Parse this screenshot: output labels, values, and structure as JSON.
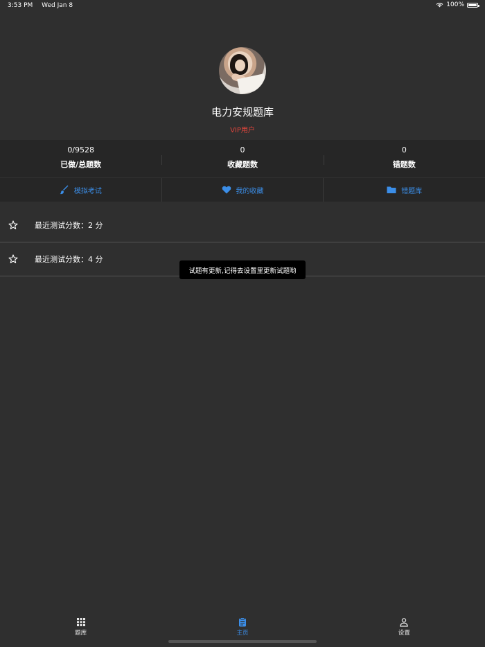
{
  "status_bar": {
    "time": "3:53 PM",
    "date": "Wed Jan 8",
    "battery": "100%"
  },
  "profile": {
    "app_name": "电力安规题库",
    "user_type": "VIP用户"
  },
  "stats": [
    {
      "value": "0/9528",
      "label": "已做/总题数"
    },
    {
      "value": "0",
      "label": "收藏题数"
    },
    {
      "value": "0",
      "label": "错题数"
    }
  ],
  "actions": [
    {
      "label": "模拟考试",
      "icon": "brush-icon"
    },
    {
      "label": "我的收藏",
      "icon": "heart-icon"
    },
    {
      "label": "错题库",
      "icon": "folder-icon"
    }
  ],
  "recent_scores": [
    {
      "text": "最近测试分数：2 分"
    },
    {
      "text": "最近测试分数：4 分"
    }
  ],
  "toast": "试题有更新,记得去设置里更新试题哟",
  "tabs": [
    {
      "label": "题库",
      "icon": "grid-icon",
      "active": false
    },
    {
      "label": "主页",
      "icon": "clipboard-icon",
      "active": true
    },
    {
      "label": "设置",
      "icon": "person-icon",
      "active": false
    }
  ],
  "colors": {
    "accent": "#3b8ee8",
    "vip": "#e0453c",
    "background": "#2f2f2f",
    "panel": "#262626"
  }
}
